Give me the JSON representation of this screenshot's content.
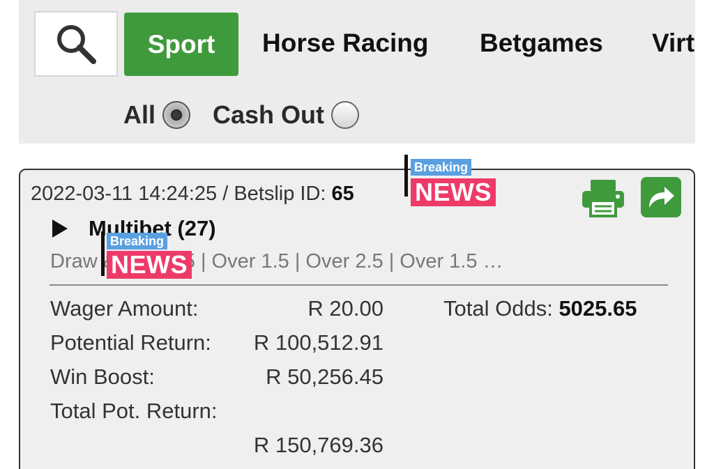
{
  "nav": {
    "search_icon": "search-icon",
    "items": [
      {
        "label": "Sport"
      },
      {
        "label": "Horse Racing"
      },
      {
        "label": "Betgames"
      },
      {
        "label": "Virt"
      }
    ],
    "filters": {
      "all_label": "All",
      "cash_out_label": "Cash Out",
      "selected": "All"
    },
    "colors": {
      "active_tab": "#3f9a3c"
    }
  },
  "bet": {
    "datetime": "2022-03-11 14:24:25",
    "betslip_label": "/ Betslip ID:",
    "betslip_id_visible": "65",
    "type_title": "Multibet (27)",
    "selections": "Draw & over 1.5 | Over 1.5 | Over 2.5 | Over 1.5 …",
    "wager_label": "Wager Amount:",
    "wager_value": "R 20.00",
    "potential_label": "Potential Return:",
    "potential_value": "R 100,512.91",
    "boost_label": "Win Boost:",
    "boost_value": "R 50,256.45",
    "total_label": "Total Pot. Return:",
    "total_value": "R 150,769.36",
    "odds_label": "Total Odds:",
    "odds_value": "5025.65",
    "icons": {
      "print": "print-icon",
      "share": "share-icon"
    },
    "colors": {
      "icon_green": "#3f9a3c"
    }
  },
  "overlays": {
    "breaking_top": "Breaking",
    "breaking_main": "NEWS"
  }
}
